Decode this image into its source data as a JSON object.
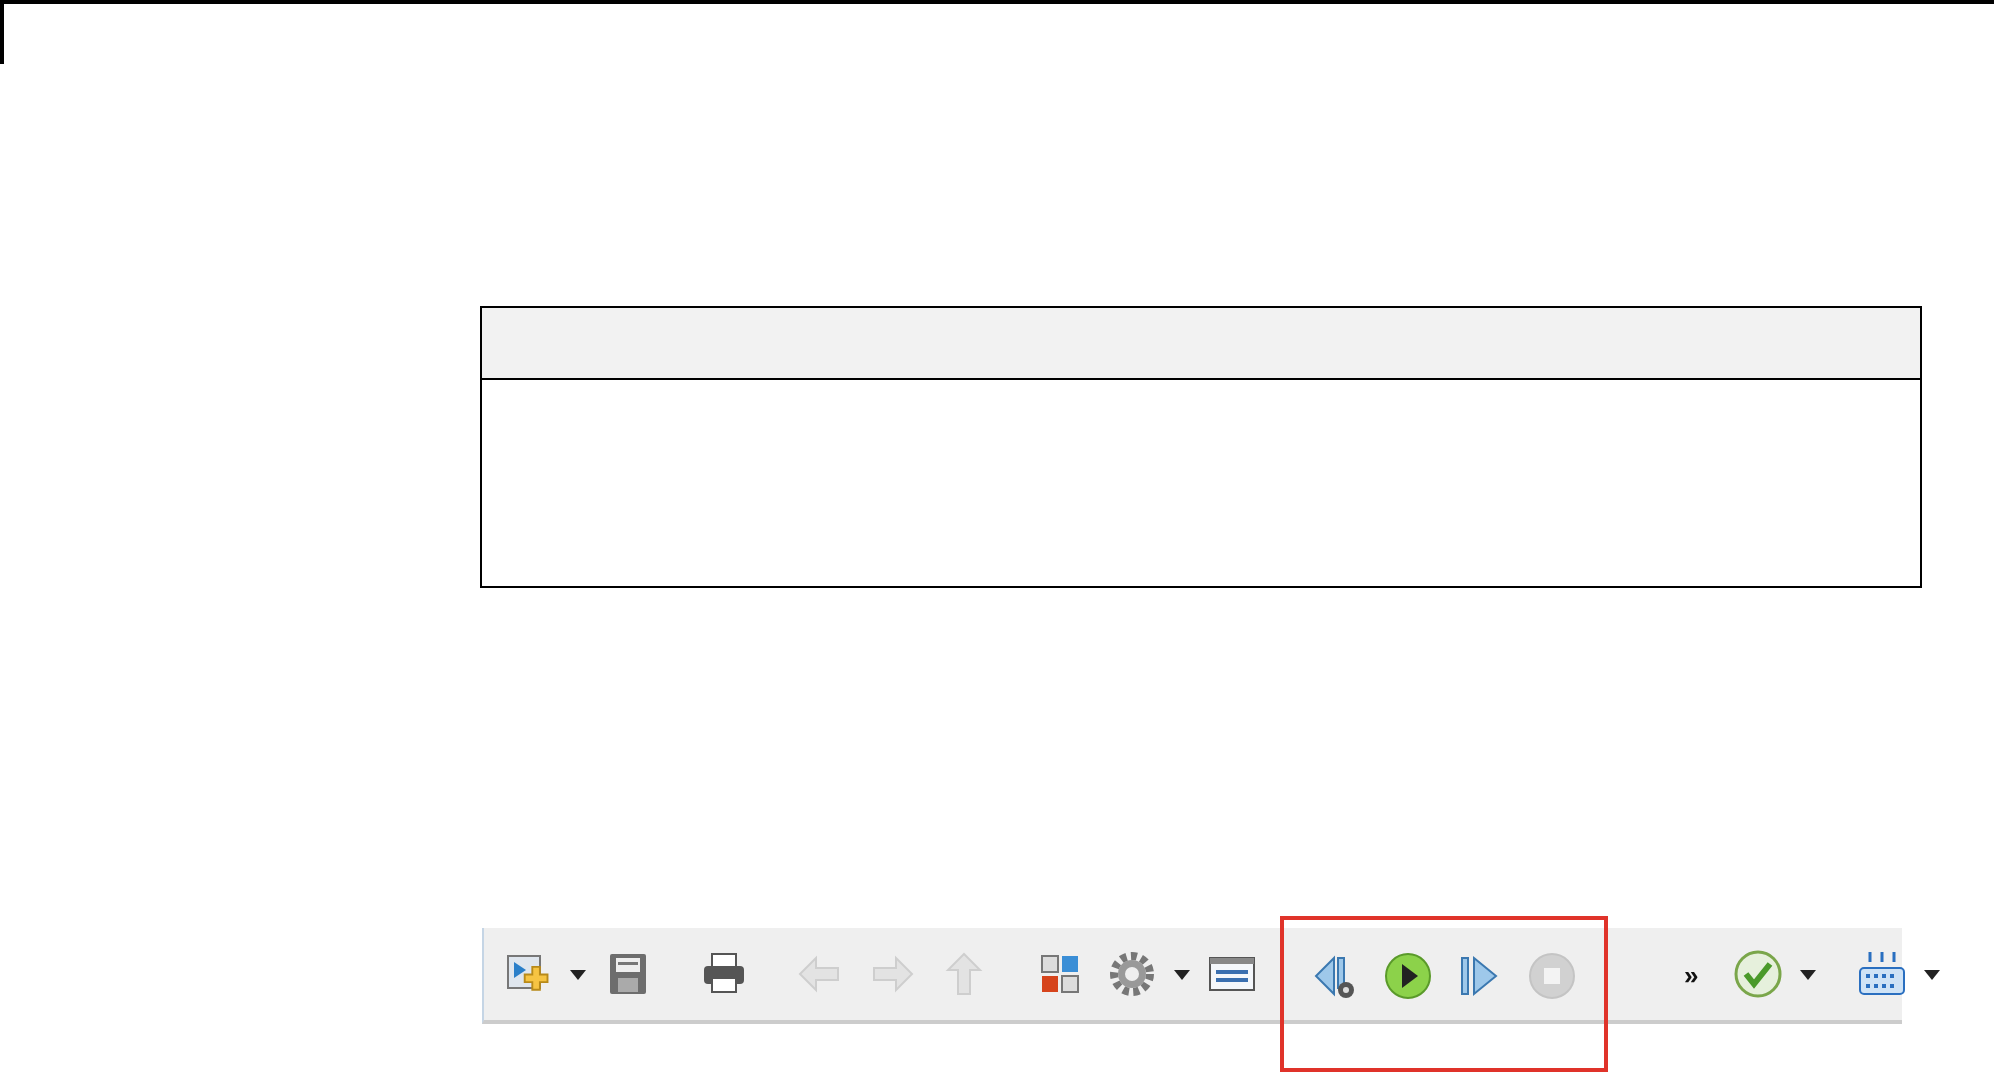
{
  "toolbar": {
    "groups": [
      {
        "highlighted": false,
        "buttons": [
          {
            "kind": "new-model",
            "dropdown": true,
            "disabled": false
          },
          {
            "kind": "save",
            "dropdown": false,
            "disabled": false
          }
        ]
      },
      {
        "highlighted": false,
        "buttons": [
          {
            "kind": "print",
            "dropdown": false,
            "disabled": false
          }
        ]
      },
      {
        "highlighted": false,
        "buttons": [
          {
            "kind": "back",
            "dropdown": false,
            "disabled": true
          },
          {
            "kind": "forward",
            "dropdown": false,
            "disabled": true
          },
          {
            "kind": "up",
            "dropdown": false,
            "disabled": true
          }
        ]
      },
      {
        "highlighted": false,
        "buttons": [
          {
            "kind": "library",
            "dropdown": false,
            "disabled": false
          },
          {
            "kind": "settings",
            "dropdown": true,
            "disabled": false
          },
          {
            "kind": "explorer",
            "dropdown": false,
            "disabled": false
          }
        ]
      },
      {
        "highlighted": true,
        "buttons": [
          {
            "kind": "step-back",
            "dropdown": false,
            "disabled": false
          },
          {
            "kind": "run",
            "dropdown": false,
            "disabled": false
          },
          {
            "kind": "step-forward",
            "dropdown": false,
            "disabled": false
          },
          {
            "kind": "stop",
            "dropdown": false,
            "disabled": true
          }
        ],
        "overflow": "»"
      },
      {
        "highlighted": false,
        "buttons": [
          {
            "kind": "check",
            "dropdown": true,
            "disabled": false
          }
        ]
      },
      {
        "highlighted": false,
        "buttons": [
          {
            "kind": "keyboard",
            "dropdown": true,
            "disabled": false
          }
        ]
      }
    ]
  }
}
